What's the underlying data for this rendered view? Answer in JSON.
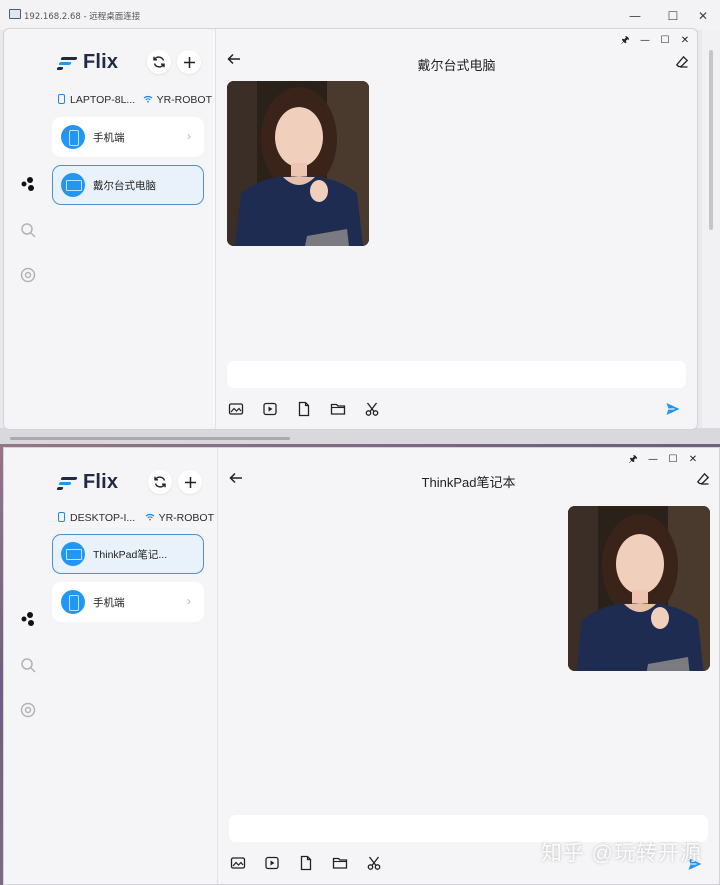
{
  "remote_desktop": {
    "title": "192.168.2.68 - 远程桌面连接",
    "controls": [
      "—",
      "☐",
      "✕"
    ]
  },
  "window_controls": [
    "🖈",
    "—",
    "☐",
    "✕"
  ],
  "top_app": {
    "brand": "Flix",
    "device_name": "LAPTOP-8L...",
    "network": "YR-ROBOT",
    "devices": [
      {
        "name": "手机端",
        "type": "phone",
        "active": false
      },
      {
        "name": "戴尔台式电脑",
        "type": "pc",
        "active": true
      }
    ],
    "chat": {
      "title": "戴尔台式电脑",
      "message_side": "left",
      "input_value": ""
    }
  },
  "bottom_app": {
    "brand": "Flix",
    "device_name": "DESKTOP-I...",
    "network": "YR-ROBOT",
    "devices": [
      {
        "name": "ThinkPad笔记...",
        "type": "pc",
        "active": true
      },
      {
        "name": "手机端",
        "type": "phone",
        "active": false
      }
    ],
    "chat": {
      "title": "ThinkPad笔记本",
      "message_side": "right",
      "input_value": ""
    }
  },
  "toolbar_tools": [
    "image-icon",
    "video-icon",
    "file-icon",
    "folder-icon",
    "scissors-icon"
  ],
  "colors": {
    "accent": "#2196f3",
    "brand_text": "#1f2a44",
    "panel_bg": "#f5f5f7",
    "active_card_border": "#4a93d8"
  },
  "watermark": "知乎 @玩转开源"
}
